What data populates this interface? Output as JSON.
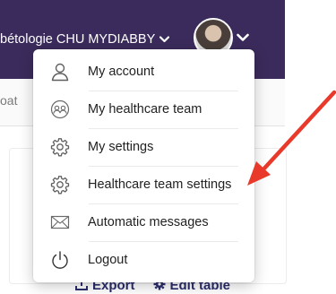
{
  "header": {
    "org_label": "bétologie CHU MYDIABBY",
    "org_caret_icon": "chevron-down-icon",
    "avatar_icon": "user-avatar",
    "avatar_caret_icon": "chevron-down-icon",
    "background": "#3b2b5c"
  },
  "subbar": {
    "tab_fragment": "oat"
  },
  "user_menu": {
    "items": [
      {
        "label": "My account",
        "icon": "person-icon"
      },
      {
        "label": "My healthcare team",
        "icon": "team-icon"
      },
      {
        "label": "My settings",
        "icon": "gear-icon"
      },
      {
        "label": "Healthcare team settings",
        "icon": "gear-icon"
      },
      {
        "label": "Automatic messages",
        "icon": "envelope-icon"
      },
      {
        "label": "Logout",
        "icon": "power-icon"
      }
    ]
  },
  "table_actions": {
    "export_label": "Export",
    "edit_table_label": "Edit table"
  },
  "annotation": {
    "arrow_color": "#e8392b"
  }
}
